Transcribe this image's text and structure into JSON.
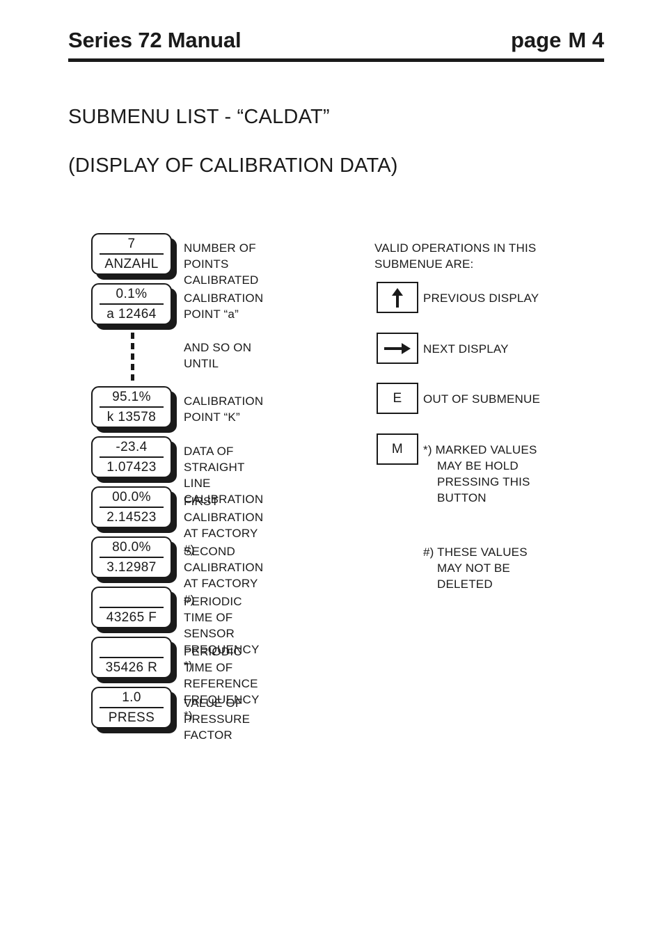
{
  "header": {
    "title": "Series 72 Manual",
    "page_label": "page",
    "page_number": "M 4"
  },
  "titles": {
    "main": "SUBMENU LIST - “CALDAT”",
    "sub": "(DISPLAY OF CALIBRATION DATA)"
  },
  "display_list": [
    {
      "top": "7",
      "bottom": "ANZAHL",
      "label": "NUMBER OF POINTS\nCALIBRATED"
    },
    {
      "top": "0.1%",
      "bottom": "a 12464",
      "label": "CALIBRATION\nPOINT “a”"
    },
    {
      "top": "95.1%",
      "bottom": "k 13578",
      "label": "CALIBRATION\nPOINT “K”"
    },
    {
      "top": "-23.4",
      "bottom": "1.07423",
      "label": "DATA OF STRAIGHT\nLINE CALIBRATION"
    },
    {
      "top": "00.0%",
      "bottom": "2.14523",
      "label": "FIRST CALIBRATION\nAT FACTORY #)"
    },
    {
      "top": "80.0%",
      "bottom": "3.12987",
      "label": "SECOND CALIBRATION\nAT FACTORY #)"
    },
    {
      "top": "",
      "bottom": "43265 F",
      "label": "PERIODIC TIME OF\nSENSOR FREQUENCY *)"
    },
    {
      "top": "",
      "bottom": "35426 R",
      "label": "PERIODIC TIME OF\nREFERENCE FREQUENCY *)"
    },
    {
      "top": "1.0",
      "bottom": "PRESS",
      "label": "VALUE OF\nPRESSURE FACTOR"
    }
  ],
  "connector": {
    "label": "AND SO ON\nUNTIL"
  },
  "operations": {
    "heading": "VALID OPERATIONS IN THIS\nSUBMENUE ARE:",
    "keys": [
      {
        "icon": "arrow-up-icon",
        "char": "",
        "label": "PREVIOUS DISPLAY"
      },
      {
        "icon": "arrow-right-icon",
        "char": "",
        "label": "NEXT DISPLAY"
      },
      {
        "icon": "letter-e-key",
        "char": "E",
        "label": "OUT OF SUBMENUE"
      },
      {
        "icon": "letter-m-key",
        "char": "M",
        "label": "*) MARKED VALUES\nMAY BE HOLD\nPRESSING THIS\nBUTTON"
      }
    ]
  },
  "footnotes": {
    "hash": "#) THESE VALUES\nMAY NOT BE\nDELETED"
  },
  "colors": {
    "ink": "#1a1a1a",
    "paper": "#ffffff"
  }
}
